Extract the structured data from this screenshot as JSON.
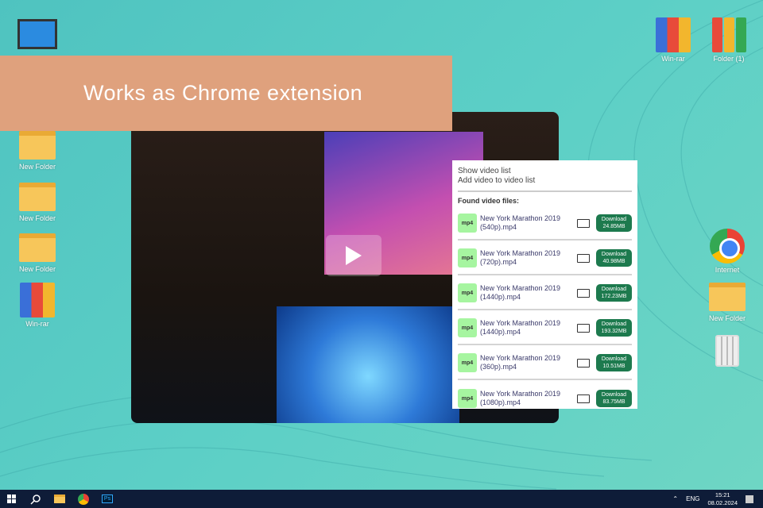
{
  "banner": {
    "text": "Works as Chrome extension"
  },
  "desktop": {
    "left": [
      "New Folder",
      "New Folder",
      "New Folder",
      "Win-rar"
    ],
    "top_right": [
      "Win-rar",
      "Folder (1)"
    ],
    "right": [
      "Internet",
      "New Folder"
    ]
  },
  "popup": {
    "show_list": "Show video list",
    "add_list": "Add video to video list",
    "found": "Found video files:",
    "files": [
      {
        "type": "mp4",
        "name": "New York Marathon 2019",
        "res": "(540p).mp4",
        "btn": "Download",
        "size": "24.85MB"
      },
      {
        "type": "mp4",
        "name": "New York Marathon 2019",
        "res": "(720p).mp4",
        "btn": "Download",
        "size": "40.98MB"
      },
      {
        "type": "mp4",
        "name": "New York Marathon 2019",
        "res": "(1440p).mp4",
        "btn": "Download",
        "size": "172.23MB"
      },
      {
        "type": "mp4",
        "name": "New York Marathon 2019",
        "res": "(1440p).mp4",
        "btn": "Download",
        "size": "193.32MB"
      },
      {
        "type": "mp4",
        "name": "New York Marathon 2019",
        "res": "(360p).mp4",
        "btn": "Download",
        "size": "10.51MB"
      },
      {
        "type": "mp4",
        "name": "New York Marathon 2019",
        "res": "(1080p).mp4",
        "btn": "Download",
        "size": "83.75MB"
      }
    ]
  },
  "taskbar": {
    "lang": "ENG",
    "time": "15:21",
    "date": "08.02.2024",
    "ps": "Ps"
  }
}
